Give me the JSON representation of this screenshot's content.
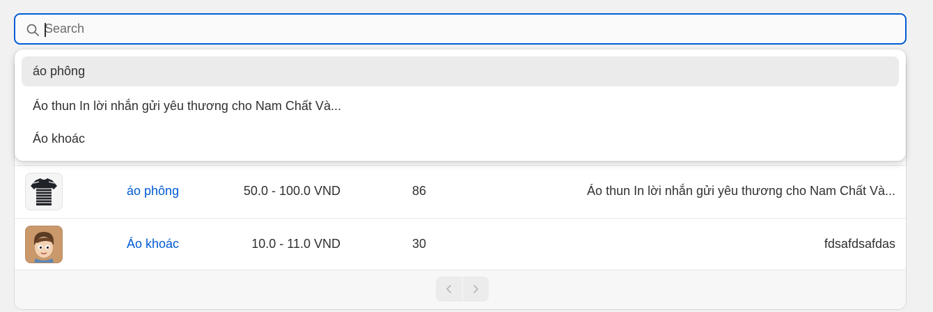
{
  "search": {
    "placeholder": "Search",
    "value": ""
  },
  "suggestions": [
    "áo phông",
    "Áo thun In lời nhắn gửi yêu thương cho Nam Chất Và...",
    "Áo khoác"
  ],
  "table": {
    "rows": [
      {
        "thumbnail": "striped-tshirt-image",
        "name": "áo phông",
        "price": "50.0 - 100.0 VND",
        "quantity": "86",
        "description": "Áo thun In lời nhắn gửi yêu thương cho Nam Chất Và..."
      },
      {
        "thumbnail": "cartoon-avatar-image",
        "name": "Áo khoác",
        "price": "10.0 - 11.0 VND",
        "quantity": "30",
        "description": "fdsafdsafdas"
      }
    ]
  },
  "pagination": {
    "prev_icon": "chevron-left-icon",
    "next_icon": "chevron-right-icon"
  },
  "colors": {
    "accent": "#005bd3",
    "highlight": "#ebebeb"
  }
}
